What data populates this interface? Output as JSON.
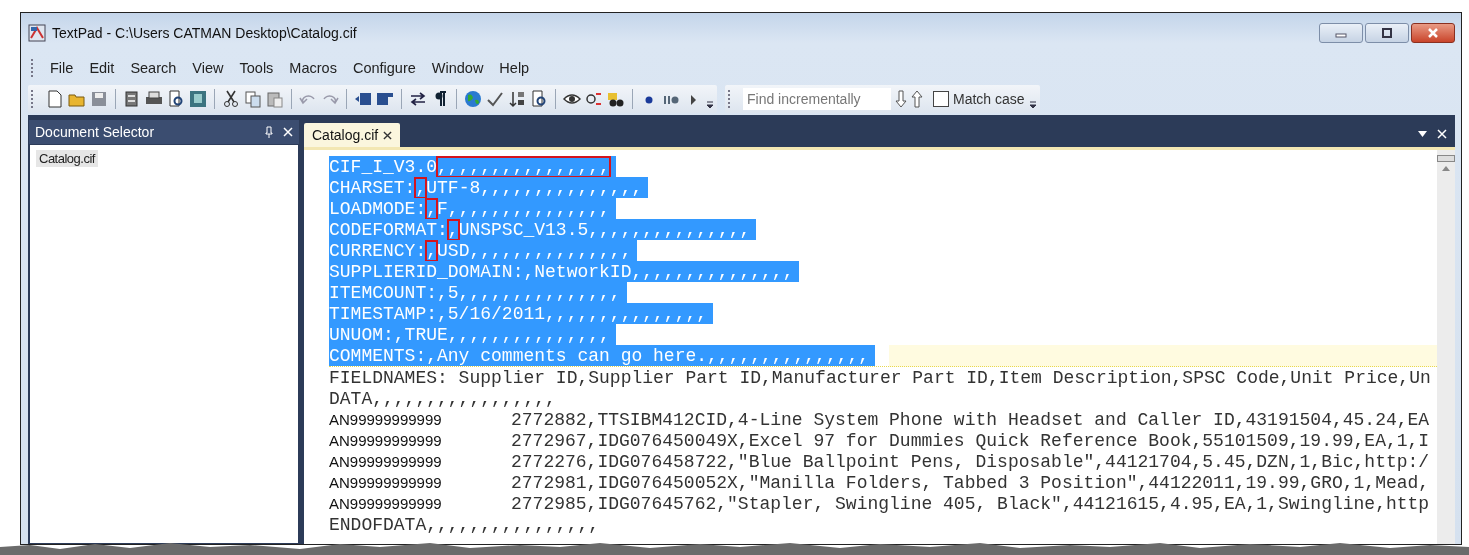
{
  "window": {
    "title": "TextPad - C:\\Users CATMAN Desktop\\Catalog.cif"
  },
  "menu": [
    "File",
    "Edit",
    "Search",
    "View",
    "Tools",
    "Macros",
    "Configure",
    "Window",
    "Help"
  ],
  "toolbar": {
    "find": {
      "placeholder": "Find incrementally"
    },
    "match_case": {
      "label": "Match case",
      "checked": false
    }
  },
  "document_selector": {
    "title": "Document Selector",
    "items": [
      {
        "label": "Catalog.cif",
        "selected": true
      }
    ]
  },
  "editor": {
    "tabs": [
      {
        "label": "Catalog.cif",
        "selected": true
      }
    ],
    "lines": [
      {
        "kind": "text",
        "selected": true,
        "current": false,
        "parts": [
          {
            "text": "CIF_I_V3.0",
            "boxed": false
          },
          {
            "text": ",,,,,,,,,,,,,,,,",
            "boxed": true
          }
        ]
      },
      {
        "kind": "text",
        "selected": true,
        "current": false,
        "parts": [
          {
            "text": "CHARSET:",
            "boxed": false
          },
          {
            "text": ",",
            "boxed": true
          },
          {
            "text": "UTF-8,,,,,,,,,,,,,,,",
            "boxed": false
          }
        ]
      },
      {
        "kind": "text",
        "selected": true,
        "current": false,
        "parts": [
          {
            "text": "LOADMODE:",
            "boxed": false
          },
          {
            "text": ",",
            "boxed": true
          },
          {
            "text": "F,,,,,,,,,,,,,,,",
            "boxed": false
          }
        ]
      },
      {
        "kind": "text",
        "selected": true,
        "current": false,
        "parts": [
          {
            "text": "CODEFORMAT:",
            "boxed": false
          },
          {
            "text": ",",
            "boxed": true
          },
          {
            "text": "UNSPSC_V13.5,,,,,,,,,,,,,,,",
            "boxed": false
          }
        ]
      },
      {
        "kind": "text",
        "selected": true,
        "current": false,
        "parts": [
          {
            "text": "CURRENCY:",
            "boxed": false
          },
          {
            "text": ",",
            "boxed": true
          },
          {
            "text": "USD,,,,,,,,,,,,,,,",
            "boxed": false
          }
        ]
      },
      {
        "kind": "text",
        "selected": true,
        "current": false,
        "parts": [
          {
            "text": "SUPPLIERID_DOMAIN:,NetworkID,,,,,,,,,,,,,,,",
            "boxed": false
          }
        ]
      },
      {
        "kind": "text",
        "selected": true,
        "current": false,
        "parts": [
          {
            "text": "ITEMCOUNT:,5,,,,,,,,,,,,,,,",
            "boxed": false
          }
        ]
      },
      {
        "kind": "text",
        "selected": true,
        "current": false,
        "parts": [
          {
            "text": "TIMESTAMP:,5/16/2011,,,,,,,,,,,,,,,",
            "boxed": false
          }
        ]
      },
      {
        "kind": "text",
        "selected": true,
        "current": false,
        "parts": [
          {
            "text": "UNUOM:,TRUE,,,,,,,,,,,,,,,",
            "boxed": false
          }
        ]
      },
      {
        "kind": "text",
        "selected": true,
        "current": true,
        "parts": [
          {
            "text": "COMMENTS:,Any comments can go here.,,,,,,,,,,,,,,,",
            "boxed": false
          }
        ]
      },
      {
        "kind": "text",
        "selected": false,
        "current": false,
        "parts": [
          {
            "text": "FIELDNAMES: Supplier ID,Supplier Part ID,Manufacturer Part ID,Item Description,SPSC Code,Unit Price,Un",
            "boxed": false
          }
        ]
      },
      {
        "kind": "text",
        "selected": false,
        "current": false,
        "parts": [
          {
            "text": "DATA,,,,,,,,,,,,,,,,,",
            "boxed": false
          }
        ]
      },
      {
        "kind": "overlay",
        "label": "AN99999999999",
        "text": "2772882,TTSIBM412CID,4-Line System Phone with Headset and Caller ID,43191504,45.24,EA"
      },
      {
        "kind": "overlay",
        "label": "AN99999999999",
        "text": "2772967,IDG076450049X,Excel 97 for Dummies Quick Reference Book,55101509,19.99,EA,1,I"
      },
      {
        "kind": "overlay",
        "label": "AN99999999999",
        "text": "2772276,IDG076458722,\"Blue Ballpoint Pens, Disposable\",44121704,5.45,DZN,1,Bic,http:/"
      },
      {
        "kind": "overlay",
        "label": "AN99999999999",
        "text": "2772981,IDG076450052X,\"Manilla Folders, Tabbed 3 Position\",44122011,19.99,GRO,1,Mead,"
      },
      {
        "kind": "overlay",
        "label": "AN99999999999",
        "text": "2772985,IDG07645762,\"Stapler, Swingline 405, Black\",44121615,4.95,EA,1,Swingline,http"
      },
      {
        "kind": "text",
        "selected": false,
        "current": false,
        "parts": [
          {
            "text": "ENDOFDATA,,,,,,,,,,,,,,,,",
            "boxed": false
          }
        ]
      }
    ]
  }
}
